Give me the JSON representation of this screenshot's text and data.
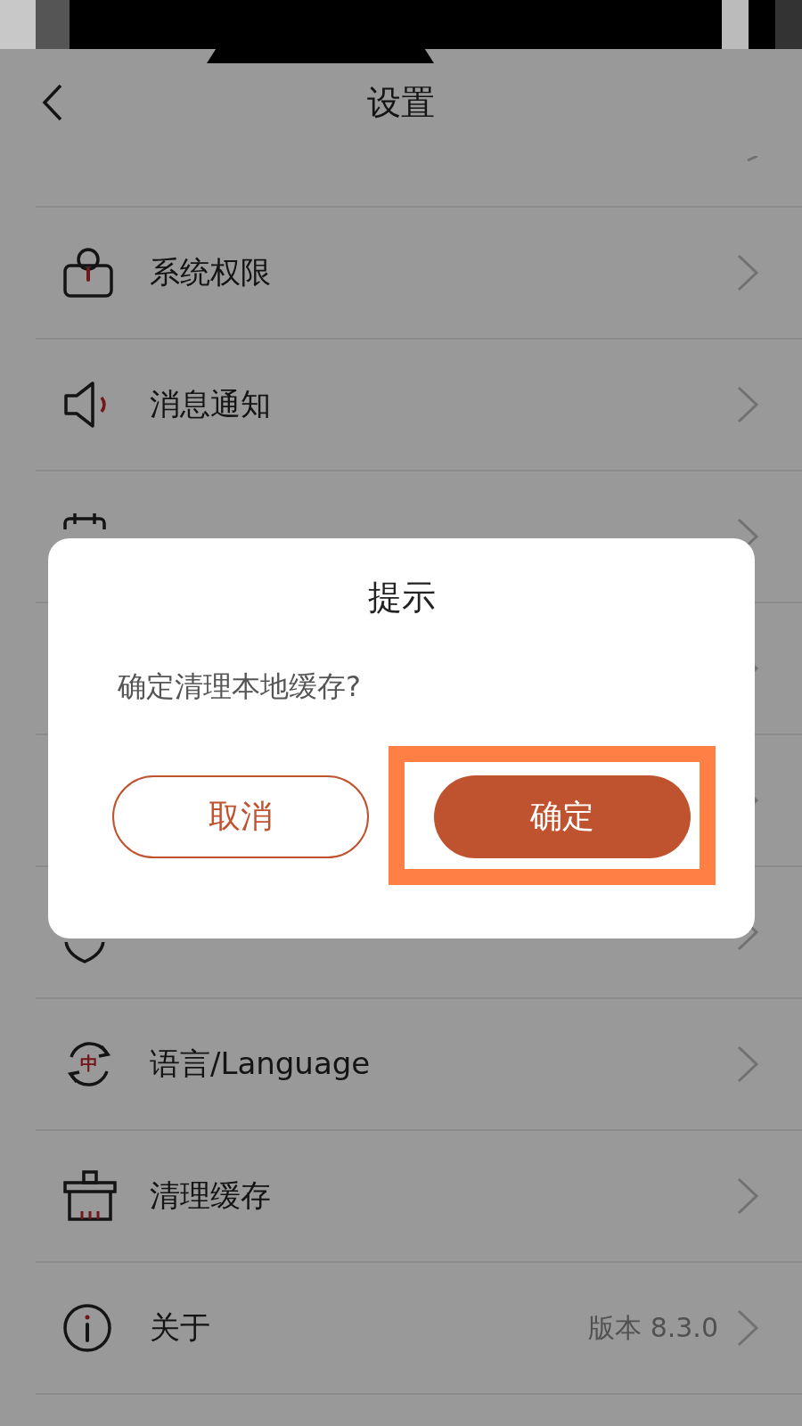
{
  "header": {
    "title": "设置"
  },
  "rows": [
    {
      "kind": "stub"
    },
    {
      "kind": "item",
      "label": "系统权限"
    },
    {
      "kind": "item",
      "label": "消息通知"
    },
    {
      "kind": "covered"
    },
    {
      "kind": "covered"
    },
    {
      "kind": "covered"
    },
    {
      "kind": "covered"
    },
    {
      "kind": "item",
      "label": "语言/Language",
      "badge": "中"
    },
    {
      "kind": "item",
      "label": "清理缓存"
    },
    {
      "kind": "item",
      "label": "关于",
      "value": "版本 8.3.0"
    }
  ],
  "dialog": {
    "title": "提示",
    "message": "确定清理本地缓存?",
    "buttons": [
      {
        "label": "取消",
        "kind": "outline",
        "highlighted": false
      },
      {
        "label": "确定",
        "kind": "filled",
        "highlighted": true
      }
    ]
  }
}
